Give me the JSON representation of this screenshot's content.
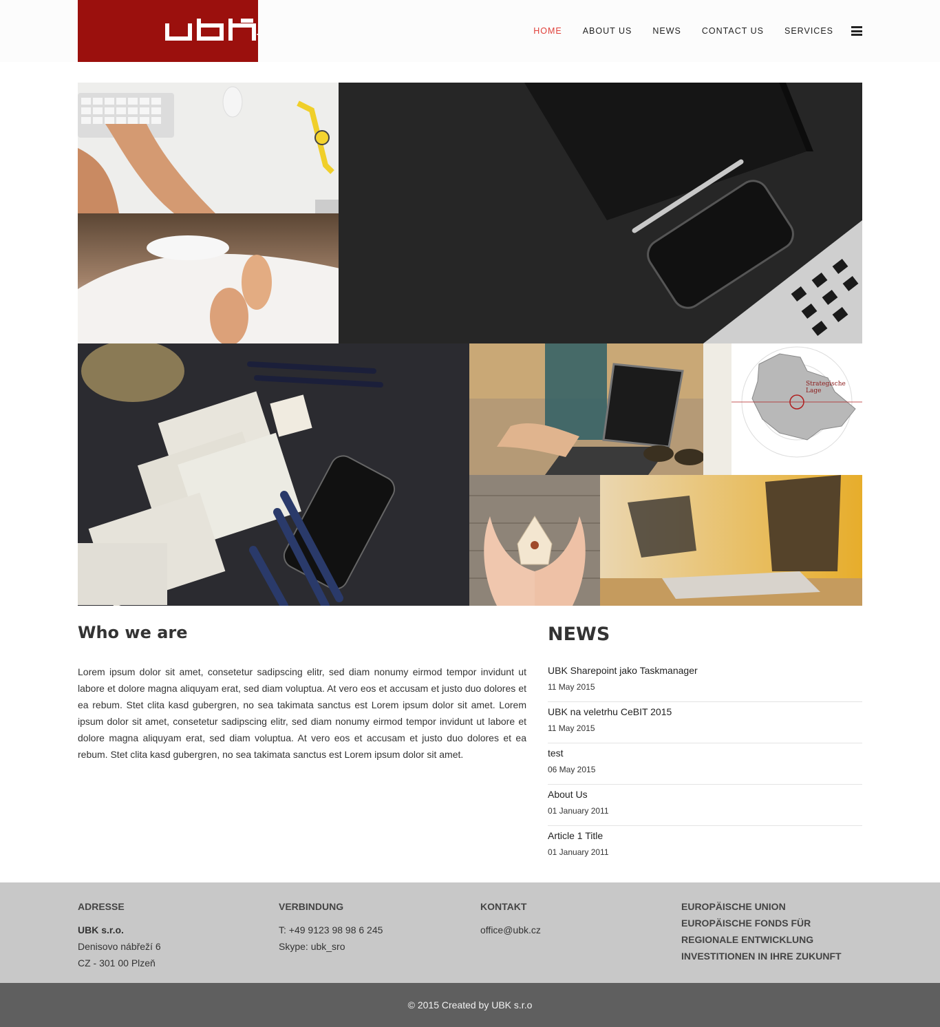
{
  "header": {
    "logo_text": "ubk",
    "nav": [
      {
        "label": "HOME",
        "active": true
      },
      {
        "label": "ABOUT US",
        "active": false
      },
      {
        "label": "NEWS",
        "active": false
      },
      {
        "label": "CONTACT US",
        "active": false
      },
      {
        "label": "SERVICES",
        "active": false
      }
    ],
    "menu_icon": "hamburger-icon"
  },
  "gallery": {
    "map_label": "Strategische Lage"
  },
  "who": {
    "title": "Who we are",
    "text": "Lorem ipsum dolor sit amet, consetetur sadipscing elitr, sed diam nonumy eirmod tempor invidunt ut labore et dolore magna aliquyam erat, sed diam voluptua. At vero eos et accusam et justo duo dolores et ea rebum. Stet clita kasd gubergren, no sea takimata sanctus est Lorem ipsum dolor sit amet. Lorem ipsum dolor sit amet, consetetur sadipscing elitr, sed diam nonumy eirmod tempor invidunt ut labore et dolore magna aliquyam erat, sed diam voluptua. At vero eos et accusam et justo duo dolores et ea rebum. Stet clita kasd gubergren, no sea takimata sanctus est Lorem ipsum dolor sit amet."
  },
  "news": {
    "title": "NEWS",
    "items": [
      {
        "title": "UBK Sharepoint jako Taskmanager",
        "date": "11 May 2015"
      },
      {
        "title": "UBK na veletrhu CeBIT 2015",
        "date": "11 May 2015"
      },
      {
        "title": "test",
        "date": "06 May 2015"
      },
      {
        "title": "About Us",
        "date": "01 January 2011"
      },
      {
        "title": "Article 1 Title",
        "date": "01 January 2011"
      }
    ]
  },
  "footer": {
    "address": {
      "heading": "ADRESSE",
      "company": "UBK s.r.o.",
      "street": "Denisovo nábřeží 6",
      "city": "CZ - 301 00 Plzeň"
    },
    "connection": {
      "heading": "VERBINDUNG",
      "phone": "T: +49 9123 98 98 6 245",
      "skype": "Skype: ubk_sro"
    },
    "contact": {
      "heading": "KONTAKT",
      "email": "office@ubk.cz"
    },
    "eu": {
      "line1": "EUROPÄISCHE UNION",
      "line2": "EUROPÄISCHE FONDS FÜR",
      "line3": "REGIONALE ENTWICKLUNG",
      "line4": "INVESTITIONEN IN IHRE ZUKUNFT"
    },
    "copyright": "© 2015 Created by UBK s.r.o"
  },
  "colors": {
    "brand": "#9b100d",
    "nav_active": "#e0403a",
    "footer_bg": "#c8c8c8",
    "copyright_bg": "#5f5f5f"
  }
}
